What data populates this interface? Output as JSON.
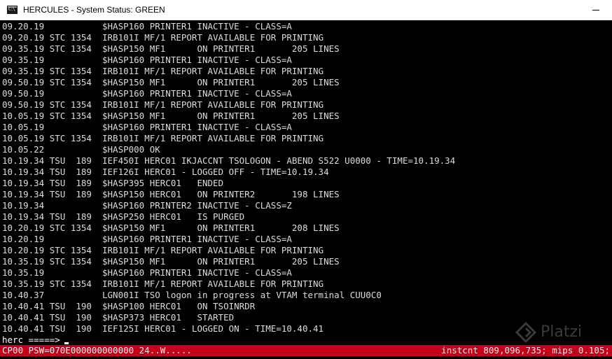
{
  "window": {
    "title": "HERCULES - System Status: GREEN",
    "icon": "command-prompt-icon"
  },
  "colors": {
    "terminal_bg": "#000000",
    "terminal_fg": "#dcdcdc",
    "status_bar_bg": "#c4001a",
    "status_bar_fg": "#f2f2f2"
  },
  "console": {
    "lines": [
      "09.20.19           $HASP160 PRINTER1 INACTIVE - CLASS=A",
      "09.20.19 STC 1354  IRB101I MF/1 REPORT AVAILABLE FOR PRINTING",
      "09.35.19 STC 1354  $HASP150 MF1      ON PRINTER1       205 LINES",
      "09.35.19           $HASP160 PRINTER1 INACTIVE - CLASS=A",
      "09.35.19 STC 1354  IRB101I MF/1 REPORT AVAILABLE FOR PRINTING",
      "09.50.19 STC 1354  $HASP150 MF1      ON PRINTER1       205 LINES",
      "09.50.19           $HASP160 PRINTER1 INACTIVE - CLASS=A",
      "09.50.19 STC 1354  IRB101I MF/1 REPORT AVAILABLE FOR PRINTING",
      "10.05.19 STC 1354  $HASP150 MF1      ON PRINTER1       205 LINES",
      "10.05.19           $HASP160 PRINTER1 INACTIVE - CLASS=A",
      "10.05.19 STC 1354  IRB101I MF/1 REPORT AVAILABLE FOR PRINTING",
      "10.05.22           $HASP000 OK",
      "10.19.34 TSU  189  IEF450I HERC01 IKJACCNT TSOLOGON - ABEND S522 U0000 - TIME=10.19.34",
      "10.19.34 TSU  189  IEF126I HERC01 - LOGGED OFF - TIME=10.19.34",
      "10.19.34 TSU  189  $HASP395 HERC01   ENDED",
      "10.19.34 TSU  189  $HASP150 HERC01   ON PRINTER2       198 LINES",
      "10.19.34           $HASP160 PRINTER2 INACTIVE - CLASS=Z",
      "10.19.34 TSU  189  $HASP250 HERC01   IS PURGED",
      "10.20.19 STC 1354  $HASP150 MF1      ON PRINTER1       208 LINES",
      "10.20.19           $HASP160 PRINTER1 INACTIVE - CLASS=A",
      "10.20.19 STC 1354  IRB101I MF/1 REPORT AVAILABLE FOR PRINTING",
      "10.35.19 STC 1354  $HASP150 MF1      ON PRINTER1       205 LINES",
      "10.35.19           $HASP160 PRINTER1 INACTIVE - CLASS=A",
      "10.35.19 STC 1354  IRB101I MF/1 REPORT AVAILABLE FOR PRINTING",
      "10.40.37           LGN001I TSO logon in progress at VTAM terminal CUU0C0",
      "10.40.41 TSU  190  $HASP100 HERC01   ON TSOINRDR",
      "10.40.41 TSU  190  $HASP373 HERC01   STARTED",
      "10.40.41 TSU  190  IEF125I HERC01 - LOGGED ON - TIME=10.40.41"
    ],
    "prompt": "herc =====>",
    "input_value": ""
  },
  "status_bar": {
    "left": "CP00 PSW=070E000000000000 24..W.....",
    "right": "instcnt 809,096,735; mips 0.105;"
  },
  "watermark": {
    "text": "Platzi"
  }
}
